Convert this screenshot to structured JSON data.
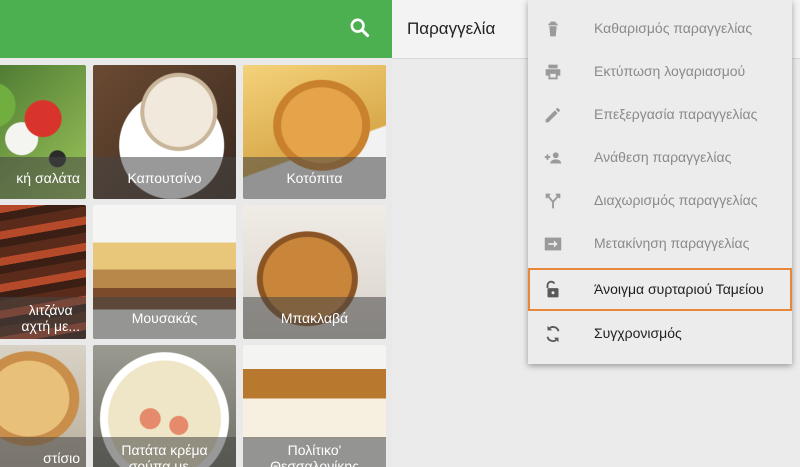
{
  "order_panel": {
    "title": "Παραγγελία"
  },
  "tiles": [
    {
      "label": "κή σαλάτα"
    },
    {
      "label": "Καπουτσίνο"
    },
    {
      "label": "Κοτόπιτα"
    },
    {
      "label": "λιτζάνα\nαχτή με..."
    },
    {
      "label": "Μουσακάς"
    },
    {
      "label": "Μπακλαβά"
    },
    {
      "label": "στίσιο"
    },
    {
      "label": "Πατάτα κρέμα\nσούπα με..."
    },
    {
      "label": "Πολίτικο'\nΘεσσαλονίκης"
    }
  ],
  "menu": {
    "items": [
      {
        "label": "Καθαρισμός παραγγελίας",
        "icon": "trash-icon",
        "enabled": false
      },
      {
        "label": "Εκτύπωση λογαριασμού",
        "icon": "printer-icon",
        "enabled": false
      },
      {
        "label": "Επεξεργασία παραγγελίας",
        "icon": "pencil-icon",
        "enabled": false
      },
      {
        "label": "Ανάθεση παραγγελίας",
        "icon": "person-add-icon",
        "enabled": false
      },
      {
        "label": "Διαχωρισμός παραγγελίας",
        "icon": "split-icon",
        "enabled": false
      },
      {
        "label": "Μετακίνηση παραγγελίας",
        "icon": "move-icon",
        "enabled": false
      },
      {
        "label": "Άνοιγμα συρταριού Ταμείου",
        "icon": "unlock-icon",
        "enabled": true,
        "highlighted": true
      },
      {
        "label": "Συγχρονισμός",
        "icon": "sync-icon",
        "enabled": true
      }
    ]
  },
  "colors": {
    "accent": "#4caf50",
    "highlight": "#e6873a"
  }
}
